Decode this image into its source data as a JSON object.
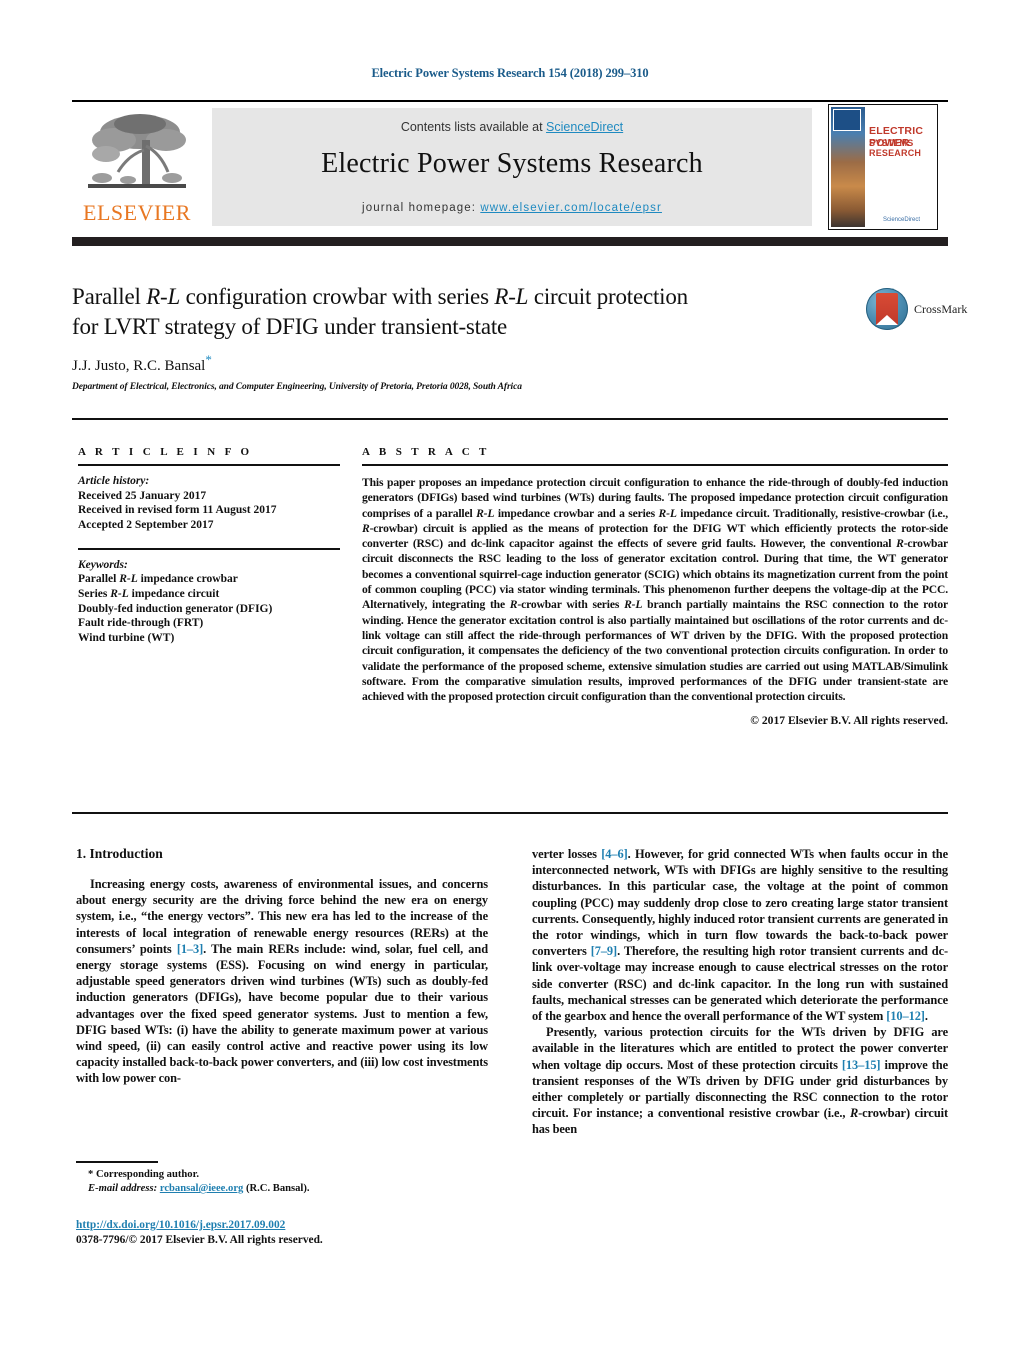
{
  "running_head": "Electric Power Systems Research 154 (2018) 299–310",
  "masthead": {
    "contents_prefix": "Contents lists available at ",
    "sciencedirect": "ScienceDirect",
    "journal_title": "Electric Power Systems Research",
    "homepage_prefix": "journal homepage: ",
    "homepage_url": "www.elsevier.com/locate/epsr",
    "publisher": "ELSEVIER",
    "cover": {
      "line1": "ELECTRIC POWER",
      "line2": "SYSTEMS RESEARCH",
      "footer": "ScienceDirect"
    }
  },
  "colors": {
    "link": "#1f8ac0",
    "reference": "#1f7fb0",
    "elsevier_orange": "#E87722",
    "band_gray": "#e6e6e6",
    "running_head": "#1a5b8a"
  },
  "title": {
    "line1_pre": "Parallel ",
    "line1_em1": "R-L",
    "line1_mid": " configuration crowbar with series ",
    "line1_em2": "R-L",
    "line1_post": " circuit protection",
    "line2": "for LVRT strategy of DFIG under transient-state"
  },
  "crossmark": {
    "label": "CrossMark"
  },
  "authors": "J.J. Justo, R.C. Bansal",
  "author_star": "*",
  "affiliation": "Department of Electrical, Electronics, and Computer Engineering, University of Pretoria, Pretoria 0028, South Africa",
  "article_info": {
    "heading": "A R T I C L E   I N F O",
    "history_label": "Article history:",
    "history": [
      "Received 25 January 2017",
      "Received in revised form 11 August 2017",
      "Accepted 2 September 2017"
    ],
    "keywords_label": "Keywords:",
    "keywords": [
      {
        "pre": "Parallel ",
        "em": "R-L",
        "post": " impedance crowbar"
      },
      {
        "pre": "Series ",
        "em": "R-L",
        "post": " impedance circuit"
      },
      {
        "pre": "Doubly-fed induction generator (DFIG)",
        "em": "",
        "post": ""
      },
      {
        "pre": "Fault ride-through (FRT)",
        "em": "",
        "post": ""
      },
      {
        "pre": "Wind turbine (WT)",
        "em": "",
        "post": ""
      }
    ]
  },
  "abstract": {
    "heading": "A B S T R A C T",
    "segments": [
      {
        "t": "This paper proposes an impedance protection circuit configuration to enhance the ride-through of doubly-fed induction generators (DFIGs) based wind turbines (WTs) during faults. The proposed impedance protection circuit configuration comprises of a parallel "
      },
      {
        "t": "R-L",
        "i": true
      },
      {
        "t": " impedance crowbar and a series "
      },
      {
        "t": "R-L",
        "i": true
      },
      {
        "t": " impedance circuit. Traditionally, resistive-crowbar (i.e., "
      },
      {
        "t": "R",
        "i": true
      },
      {
        "t": "-crowbar) circuit is applied as the means of protection for the DFIG WT which efficiently protects the rotor-side converter (RSC) and dc-link capacitor against the effects of severe grid faults. However, the conventional "
      },
      {
        "t": "R",
        "i": true
      },
      {
        "t": "-crowbar circuit disconnects the RSC leading to the loss of generator excitation control. During that time, the WT generator becomes a conventional squirrel-cage induction generator (SCIG) which obtains its magnetization current from the point of common coupling (PCC) via stator winding terminals. This phenomenon further deepens the voltage-dip at the PCC. Alternatively, integrating the "
      },
      {
        "t": "R",
        "i": true
      },
      {
        "t": "-crowbar with series "
      },
      {
        "t": "R-L",
        "i": true
      },
      {
        "t": " branch partially maintains the RSC connection to the rotor winding. Hence the generator excitation control is also partially maintained but oscillations of the rotor currents and dc-link voltage can still affect the ride-through performances of WT driven by the DFIG. With the proposed protection circuit configuration, it compensates the deficiency of the two conventional protection circuits configuration. In order to validate the performance of the proposed scheme, extensive simulation studies are carried out using MATLAB/Simulink software. From the comparative simulation results, improved performances of the DFIG under transient-state are achieved with the proposed protection circuit configuration than the conventional protection circuits."
      }
    ],
    "copyright": "© 2017 Elsevier B.V. All rights reserved."
  },
  "body": {
    "section_number_title": "1.  Introduction",
    "left_paragraphs": [
      {
        "segments": [
          {
            "t": "Increasing energy costs, awareness of environmental issues, and concerns about energy security are the driving force behind the new era on energy system, i.e., “the energy vectors”. This new era has led to the increase of the interests of local integration of renewable energy resources (RERs) at the consumers’ points "
          },
          {
            "t": "[1–3]",
            "ref": true
          },
          {
            "t": ". The main RERs include: wind, solar, fuel cell, and energy storage systems (ESS). Focusing on wind energy in particular, adjustable speed generators driven wind turbines (WTs) such as doubly-fed induction generators (DFIGs), have become popular due to their various advantages over the fixed speed generator systems. Just to mention a few, DFIG based WTs: (i) have the ability to generate maximum power at various wind speed, (ii) can easily control active and reactive power using its low capacity installed back-to-back power converters, and (iii) low cost investments with low power con-"
          }
        ]
      }
    ],
    "right_paragraphs": [
      {
        "indent": false,
        "segments": [
          {
            "t": "verter losses "
          },
          {
            "t": "[4–6]",
            "ref": true
          },
          {
            "t": ". However, for grid connected WTs when faults occur in the interconnected network, WTs with DFIGs are highly sensitive to the resulting disturbances. In this particular case, the voltage at the point of common coupling (PCC) may suddenly drop close to zero creating large stator transient currents. Consequently, highly induced rotor transient currents are generated in the rotor windings, which in turn flow towards the back-to-back power converters "
          },
          {
            "t": "[7–9]",
            "ref": true
          },
          {
            "t": ". Therefore, the resulting high rotor transient currents and dc-link over-voltage may increase enough to cause electrical stresses on the rotor side converter (RSC) and dc-link capacitor. In the long run with sustained faults, mechanical stresses can be generated which deteriorate the performance of the gearbox and hence the overall performance of the WT system "
          },
          {
            "t": "[10–12]",
            "ref": true
          },
          {
            "t": "."
          }
        ]
      },
      {
        "indent": true,
        "segments": [
          {
            "t": "Presently, various protection circuits for the WTs driven by DFIG are available in the literatures which are entitled to protect the power converter when voltage dip occurs. Most of these protection circuits "
          },
          {
            "t": "[13–15]",
            "ref": true
          },
          {
            "t": " improve the transient responses of the WTs driven by DFIG under grid disturbances by either completely or partially disconnecting the RSC connection to the rotor circuit. For instance; a conventional resistive crowbar (i.e., "
          },
          {
            "t": "R",
            "i": true
          },
          {
            "t": "-crowbar) circuit has been"
          }
        ]
      }
    ]
  },
  "footnote": {
    "star": "*",
    "corresponding": " Corresponding author.",
    "email_label": "E-mail address:",
    "email": "rcbansal@ieee.org",
    "email_suffix": " (R.C. Bansal)."
  },
  "doi": {
    "url": "http://dx.doi.org/10.1016/j.epsr.2017.09.002",
    "issn_line": "0378-7796/© 2017 Elsevier B.V. All rights reserved."
  }
}
